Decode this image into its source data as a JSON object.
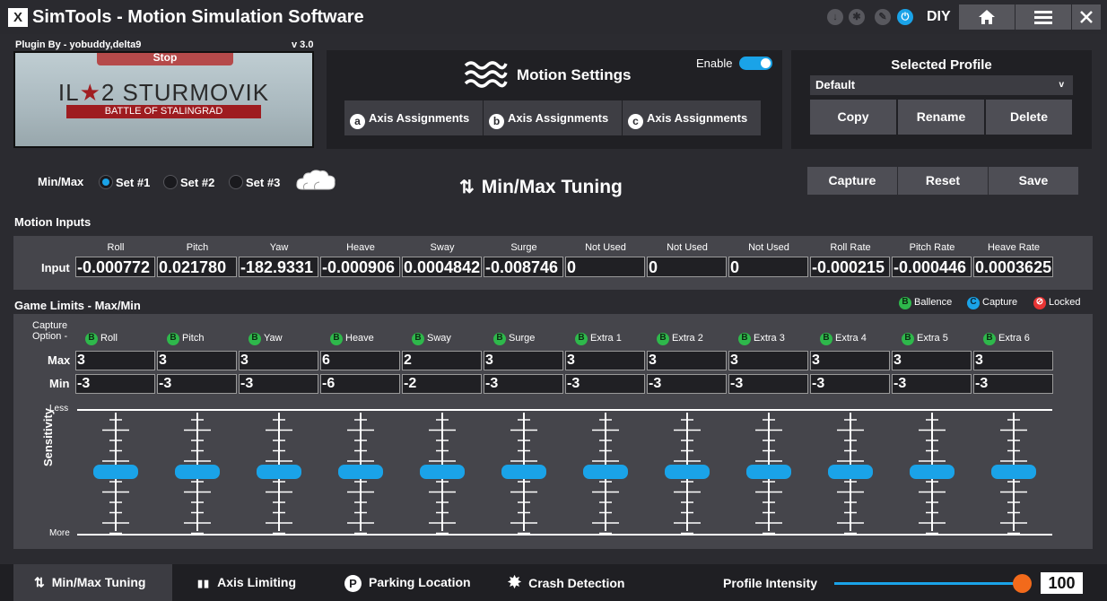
{
  "app": {
    "logo_glyph": "X",
    "title": "SimTools - Motion Simulation Software",
    "diy": "DIY",
    "title_icons": [
      "download-icon",
      "settings-cog-icon",
      "edit-icon",
      "power-icon"
    ]
  },
  "game": {
    "plugin_by": "Plugin By - yobuddy,delta9",
    "version": "v 3.0",
    "stop_label": "Stop",
    "name_left": "IL",
    "name_star": "★",
    "name_right": "2 STURMOVIK",
    "subtitle": "BATTLE OF STALINGRAD"
  },
  "motion_settings": {
    "title": "Motion Settings",
    "enable_label": "Enable",
    "enabled": true,
    "axis_buttons": [
      {
        "letter": "a",
        "label": "Axis Assignments"
      },
      {
        "letter": "b",
        "label": "Axis Assignments"
      },
      {
        "letter": "c",
        "label": "Axis Assignments"
      }
    ]
  },
  "profile": {
    "title": "Selected Profile",
    "selected": "Default",
    "chevron": "v",
    "copy": "Copy",
    "rename": "Rename",
    "delete": "Delete"
  },
  "tuning": {
    "minmax_label": "Min/Max",
    "sets": [
      "Set #1",
      "Set #2",
      "Set #3"
    ],
    "selected_set": 0,
    "title": "Min/Max Tuning",
    "capture": "Capture",
    "reset": "Reset",
    "save": "Save"
  },
  "motion_inputs": {
    "title": "Motion Inputs",
    "row_label": "Input",
    "columns": [
      "Roll",
      "Pitch",
      "Yaw",
      "Heave",
      "Sway",
      "Surge",
      "Not Used",
      "Not Used",
      "Not Used",
      "Roll Rate",
      "Pitch Rate",
      "Heave Rate"
    ],
    "values": [
      "-0.000772",
      "0.021780",
      "-182.9331",
      "-0.000906",
      "0.0004842",
      "-0.008746",
      "0",
      "0",
      "0",
      "-0.000215",
      "-0.000446",
      "0.0003625"
    ]
  },
  "game_limits": {
    "title": "Game Limits - Max/Min",
    "capture_option": "Capture\nOption -",
    "legend": [
      {
        "icon": "B",
        "label": "Ballence",
        "color": "#2eb84b"
      },
      {
        "icon": "C",
        "label": "Capture",
        "color": "#1aa3e8"
      },
      {
        "icon": "⊘",
        "label": "Locked",
        "color": "#e83434"
      }
    ],
    "columns": [
      "Roll",
      "Pitch",
      "Yaw",
      "Heave",
      "Sway",
      "Surge",
      "Extra 1",
      "Extra 2",
      "Extra 3",
      "Extra 4",
      "Extra 5",
      "Extra 6"
    ],
    "column_icon": "B",
    "max_label": "Max",
    "min_label": "Min",
    "max_values": [
      "3",
      "3",
      "3",
      "6",
      "2",
      "3",
      "3",
      "3",
      "3",
      "3",
      "3",
      "3"
    ],
    "min_values": [
      "-3",
      "-3",
      "-3",
      "-6",
      "-2",
      "-3",
      "-3",
      "-3",
      "-3",
      "-3",
      "-3",
      "-3"
    ],
    "sensitivity_label": "Sensitivity",
    "less_label": "Less",
    "more_label": "More",
    "sensitivity_levels": [
      0.5,
      0.5,
      0.5,
      0.5,
      0.5,
      0.5,
      0.5,
      0.5,
      0.5,
      0.5,
      0.5,
      0.5
    ]
  },
  "bottom": {
    "tabs": [
      {
        "icon": "up-down-arrows-icon",
        "glyph": "⇅",
        "label": "Min/Max Tuning",
        "active": true
      },
      {
        "icon": "axis-bars-icon",
        "glyph": "▮▮",
        "label": "Axis Limiting",
        "active": false
      },
      {
        "icon": "parking-icon",
        "glyph": "P",
        "label": "Parking Location",
        "active": false
      },
      {
        "icon": "crash-icon",
        "glyph": "✸",
        "label": "Crash Detection",
        "active": false
      }
    ],
    "intensity_label": "Profile Intensity",
    "intensity_value": "100",
    "intensity_fraction": 1.0
  },
  "colors": {
    "accent": "#1aa3e8",
    "slider_thumb": "#f26a1b",
    "balance_green": "#2eb84b",
    "locked_red": "#e83434"
  }
}
